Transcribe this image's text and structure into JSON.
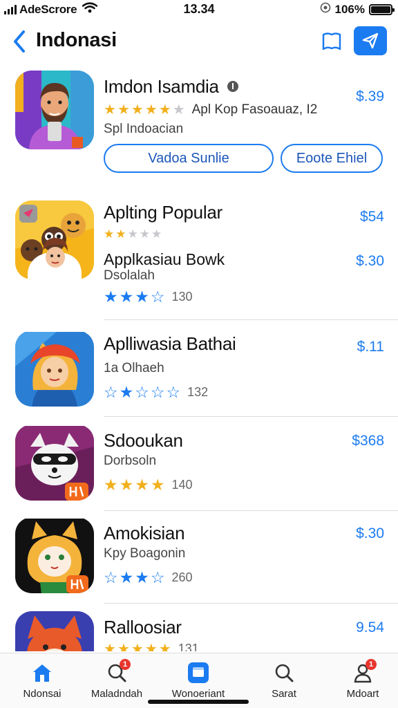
{
  "status_bar": {
    "carrier": "AdeScrore",
    "time": "13.34",
    "battery": "106%"
  },
  "nav": {
    "title": "Indonasi",
    "back_icon": "chevron-left-icon",
    "bookmark_icon": "book-icon",
    "share_icon": "paper-plane-icon"
  },
  "apps": [
    {
      "name": "Imdon Isamdia",
      "price": "$.39",
      "rating_line": "Apl Kop Fasoauaz, I2",
      "rating_stars": 5,
      "subtitle": "Spl Indoacian",
      "buttons": [
        "Vadoa Sunlie",
        "Eoote Ehiel"
      ]
    },
    {
      "name": "Aplting Popular",
      "price": "$54",
      "rating_stars": 2,
      "second_name": "Applkasiau Bowk",
      "second_price": "$.30",
      "subtitle": "Dsolalah",
      "second_stars": 4,
      "count": "130"
    },
    {
      "name": "Aplliwasia Bathai",
      "price": "$.11",
      "subtitle": "1a Olhaeh",
      "rating_stars": 2,
      "count": "132"
    },
    {
      "name": "Sdooukan",
      "price": "$368",
      "subtitle": "Dorbsoln",
      "rating_stars": 4,
      "count": "140"
    },
    {
      "name": "Amokisian",
      "price": "$.30",
      "subtitle": "Kpy Boagonin",
      "rating_stars": 4,
      "count": "260"
    },
    {
      "name": "Ralloosiar",
      "price": "9.54",
      "rating_stars": 5,
      "count": "131"
    }
  ],
  "tabs": [
    {
      "label": "Ndonsai",
      "icon": "home-icon",
      "badge": ""
    },
    {
      "label": "Maladndah",
      "icon": "search-icon",
      "badge": "1"
    },
    {
      "label": "Wonoeriant",
      "icon": "apps-icon",
      "badge": ""
    },
    {
      "label": "Sarat",
      "icon": "search-icon",
      "badge": ""
    },
    {
      "label": "Mdoart",
      "icon": "person-icon",
      "badge": "1"
    }
  ],
  "colors": {
    "accent": "#1b7bf0",
    "star_gold": "#f2b01e",
    "star_grey": "#c7c7cc",
    "badge_red": "#e8362e"
  }
}
